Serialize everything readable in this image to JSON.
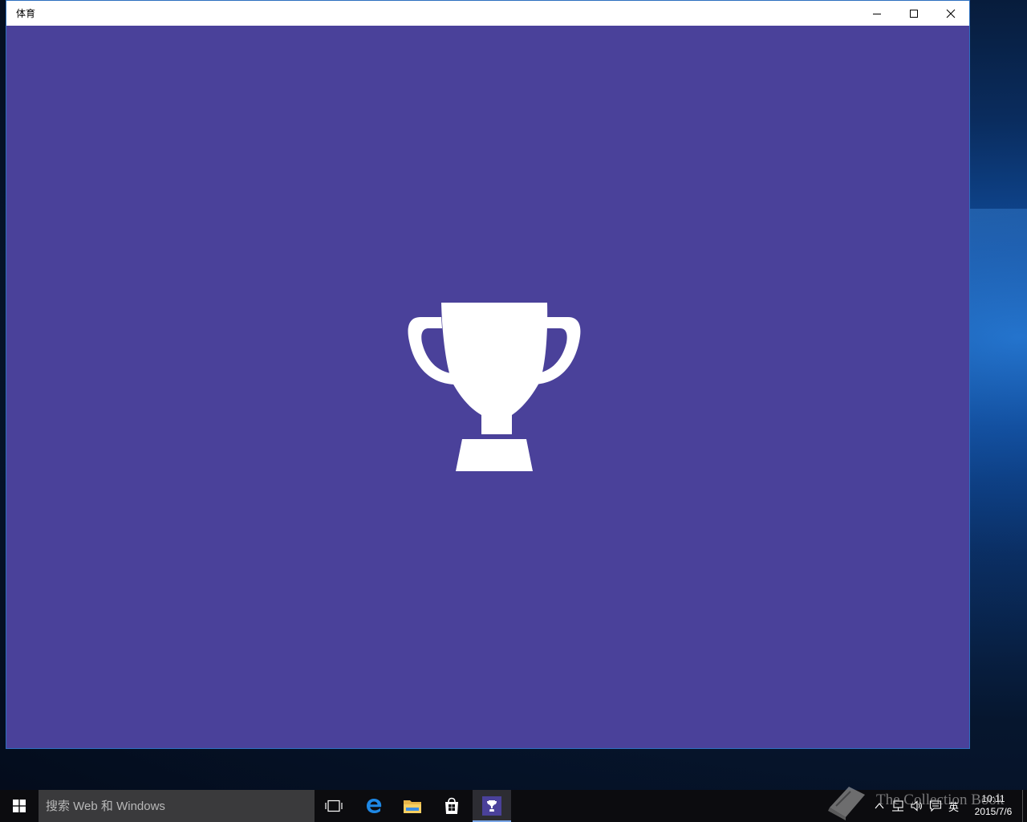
{
  "window": {
    "title": "体育",
    "background_color": "#4a419a",
    "controls": {
      "minimize": "minimize-icon",
      "maximize": "maximize-icon",
      "close": "close-icon"
    },
    "splash_icon": "trophy-icon"
  },
  "taskbar": {
    "search_placeholder": "搜索 Web 和 Windows",
    "pinned": [
      {
        "name": "task-view",
        "icon": "task-view-icon"
      },
      {
        "name": "edge",
        "icon": "edge-icon"
      },
      {
        "name": "file-explorer",
        "icon": "folder-icon"
      },
      {
        "name": "store",
        "icon": "store-icon"
      },
      {
        "name": "sports",
        "icon": "trophy-icon",
        "active": true
      }
    ],
    "tray": {
      "language": "英",
      "time": "10:11",
      "date": "2015/7/6"
    },
    "accent_color": "#7aa7e8"
  },
  "watermark": {
    "text": "The Collection Book"
  }
}
